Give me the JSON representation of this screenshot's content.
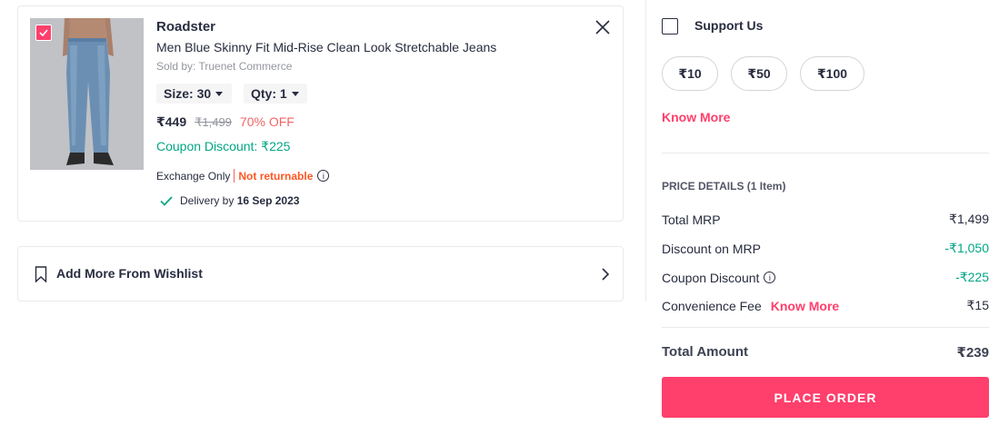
{
  "cart_item": {
    "brand": "Roadster",
    "name": "Men Blue Skinny Fit Mid-Rise Clean Look Stretchable Jeans",
    "seller": "Sold by: Truenet Commerce",
    "size_label": "Size: 30",
    "qty_label": "Qty: 1",
    "price": "₹449",
    "mrp": "₹1,499",
    "discount": "70% OFF",
    "coupon_discount": "Coupon Discount: ₹225",
    "exchange": "Exchange Only",
    "returnable": "Not returnable",
    "delivery_prefix": "Delivery by",
    "delivery_date": "16 Sep 2023",
    "selected": true
  },
  "wishlist": {
    "label": "Add More From Wishlist"
  },
  "support": {
    "label": "Support Us",
    "amounts": [
      "₹10",
      "₹50",
      "₹100"
    ],
    "know_more": "Know More"
  },
  "price_details": {
    "header": "PRICE DETAILS (1 Item)",
    "rows": [
      {
        "label": "Total MRP",
        "value": "₹1,499"
      },
      {
        "label": "Discount on MRP",
        "value": "-₹1,050"
      },
      {
        "label": "Coupon Discount",
        "value": "-₹225"
      },
      {
        "label": "Convenience Fee",
        "value": "₹15",
        "link": "Know More"
      }
    ],
    "total_label": "Total Amount",
    "total_value": "₹239"
  },
  "place_order": "PLACE ORDER",
  "colors": {
    "accent": "#ff3f6c",
    "green": "#03a685",
    "discount": "#f16565"
  },
  "icons": [
    "checkbox-checked-icon",
    "close-icon",
    "caret-down-icon",
    "info-icon",
    "check-icon",
    "bookmark-icon",
    "chevron-right-icon",
    "checkbox-icon"
  ]
}
